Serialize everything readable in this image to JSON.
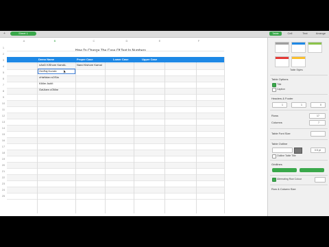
{
  "toolbar": {
    "add_sheet": "+",
    "sheet_name": "Sheet 1"
  },
  "format_tabs": [
    "Table",
    "Cell",
    "Text",
    "Arrange"
  ],
  "columns": [
    "A",
    "B",
    "C",
    "D",
    "E",
    "F"
  ],
  "rows": [
    "1",
    "2",
    "3",
    "4",
    "5",
    "6",
    "7",
    "8",
    "9",
    "10",
    "11",
    "12",
    "13",
    "14",
    "15",
    "16",
    "17",
    "18",
    "19",
    "20",
    "21",
    "22",
    "23",
    "24",
    "25"
  ],
  "table": {
    "title": "How To Change The Case Of Text In Numbers",
    "headers": [
      "Demo Name",
      "Proper Case",
      "Lower Case",
      "Upper Case"
    ],
    "data": [
      [
        "nAnD KiShore KamAL",
        "Nand Kishore Kamal",
        "",
        ""
      ],
      [
        "OmRaj KumAr",
        "",
        "",
        ""
      ],
      [
        "cHaNdan sOSia",
        "",
        "",
        ""
      ],
      [
        "KiMer AshIt",
        "",
        "",
        ""
      ],
      [
        "GaUtam cOMar",
        "",
        "",
        ""
      ]
    ]
  },
  "sidebar": {
    "table_styles": "Table Styles",
    "table_options": "Table Options",
    "title_opt": "Title",
    "caption_opt": "Caption",
    "headers_footer": "Headers & Footer",
    "hdr_vals": [
      "1",
      "1",
      "0"
    ],
    "rows_label": "Rows",
    "rows_val": "17",
    "cols_label": "Columns",
    "cols_val": "7",
    "font_size_label": "Table Font Size",
    "table_outline": "Table Outline",
    "outline_pt": "0.5 pt",
    "outline_title": "Outline Table Title",
    "gridlines": "Gridlines",
    "alt_row": "Alternating Row Colour",
    "row_col_size": "Row & Column Size",
    "accent": "#3aa84b",
    "header_blue": "#1e88e5"
  }
}
